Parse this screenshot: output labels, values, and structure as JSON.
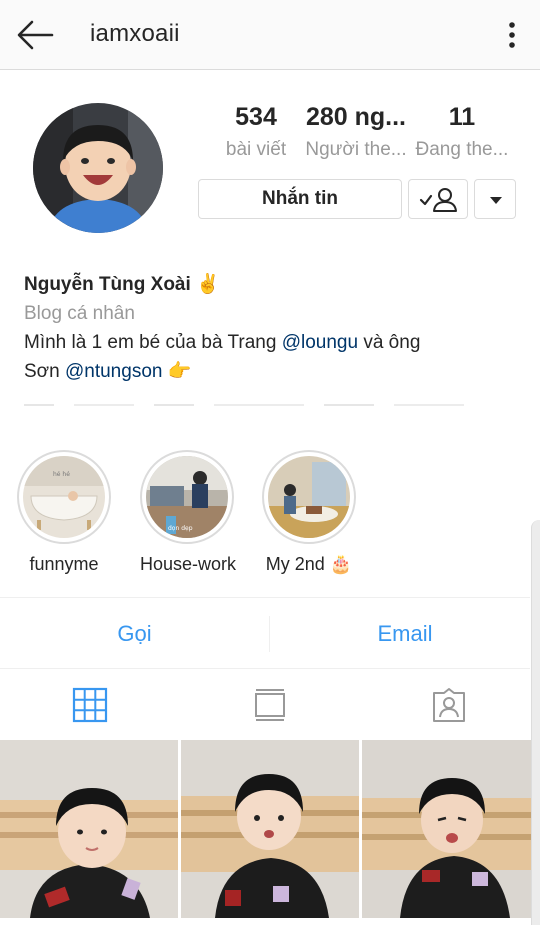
{
  "header": {
    "username": "iamxoaii",
    "back_icon": "arrow-left-icon",
    "menu_icon": "vertical-dots-icon"
  },
  "stats": {
    "posts": {
      "value": "534",
      "label": "bài viết"
    },
    "followers": {
      "value": "280 ng...",
      "label": "Người the..."
    },
    "following": {
      "value": "11",
      "label": "Đang the..."
    }
  },
  "actions": {
    "message": "Nhắn tin",
    "follow_icon": "person-check-icon",
    "dropdown_icon": "caret-down-icon"
  },
  "bio": {
    "name": "Nguyễn Tùng Xoài ✌️",
    "category": "Blog cá nhân",
    "line1_text": "Mình là 1 em bé của bà Trang ",
    "mention1": "@loungu",
    "line1_end": " và ông",
    "line2_text": "Sơn ",
    "mention2": "@ntungson",
    "line2_end": " 👉"
  },
  "highlights": [
    {
      "label": "funnyme"
    },
    {
      "label": "House-work"
    },
    {
      "label": "My 2nd 🎂"
    }
  ],
  "contact": {
    "call": "Gọi",
    "email": "Email"
  },
  "tabs": [
    {
      "icon": "grid-icon",
      "active": true
    },
    {
      "icon": "feed-icon",
      "active": false
    },
    {
      "icon": "tagged-icon",
      "active": false
    }
  ],
  "colors": {
    "accent": "#3897f0",
    "mention": "#003569",
    "secondary_text": "#999999",
    "border": "#dbdbdb"
  }
}
